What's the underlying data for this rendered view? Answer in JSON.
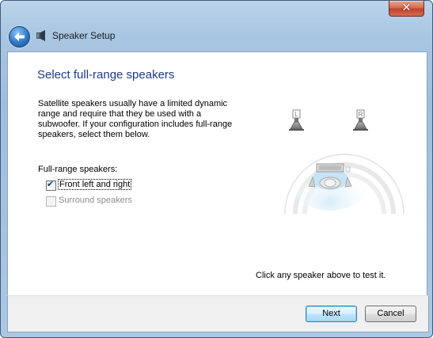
{
  "window": {
    "title": "Speaker Setup",
    "close_label": "✕"
  },
  "page": {
    "heading": "Select full-range speakers",
    "description": "Satellite speakers usually have a limited dynamic range and require that they be used with a subwoofer.  If your configuration includes full-range speakers, select them below.",
    "group_label": "Full-range speakers:",
    "options": [
      {
        "label": "Front left and right",
        "checked": true,
        "enabled": true
      },
      {
        "label": "Surround speakers",
        "checked": false,
        "enabled": false
      }
    ],
    "speaker_labels": {
      "left": "L",
      "right": "R"
    },
    "test_hint": "Click any speaker above to test it."
  },
  "footer": {
    "next_label": "Next",
    "cancel_label": "Cancel"
  },
  "colors": {
    "heading": "#1e3a8a",
    "accent": "#3c7fb1"
  }
}
